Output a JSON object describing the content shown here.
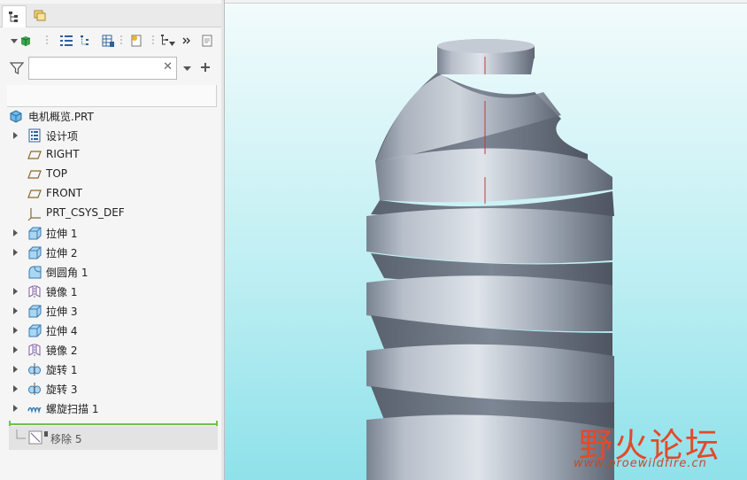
{
  "panel": {
    "search": {
      "value": "",
      "placeholder": ""
    },
    "tree": {
      "root": {
        "label": "电机概览.PRT",
        "icon": "part-icon"
      },
      "items": [
        {
          "label": "设计项",
          "icon": "design-items-icon",
          "expandable": true
        },
        {
          "label": "RIGHT",
          "icon": "datum-plane-icon",
          "expandable": false
        },
        {
          "label": "TOP",
          "icon": "datum-plane-icon",
          "expandable": false
        },
        {
          "label": "FRONT",
          "icon": "datum-plane-icon",
          "expandable": false
        },
        {
          "label": "PRT_CSYS_DEF",
          "icon": "csys-icon",
          "expandable": false
        },
        {
          "label": "拉伸 1",
          "icon": "extrude-icon",
          "expandable": true
        },
        {
          "label": "拉伸 2",
          "icon": "extrude-icon",
          "expandable": true
        },
        {
          "label": "倒圆角 1",
          "icon": "round-icon",
          "expandable": true
        },
        {
          "label": "镜像 1",
          "icon": "mirror-icon",
          "expandable": true
        },
        {
          "label": "拉伸 3",
          "icon": "extrude-icon",
          "expandable": true
        },
        {
          "label": "拉伸 4",
          "icon": "extrude-icon",
          "expandable": true
        },
        {
          "label": "镜像 2",
          "icon": "mirror-icon",
          "expandable": true
        },
        {
          "label": "旋转 1",
          "icon": "revolve-icon",
          "expandable": true
        },
        {
          "label": "旋转 3",
          "icon": "revolve-icon",
          "expandable": true
        },
        {
          "label": "螺旋扫描 1",
          "icon": "helical-sweep-icon",
          "expandable": true
        }
      ],
      "insert": {
        "label": "移除 5",
        "icon": "remove-feature-icon"
      }
    }
  },
  "watermark": {
    "title": "野火论坛",
    "url": "www.proewildfire.cn"
  },
  "colors": {
    "accent_green": "#6fc24b",
    "model_gray": "#9aa3b0",
    "viewport_bottom": "#8fe1ea"
  }
}
